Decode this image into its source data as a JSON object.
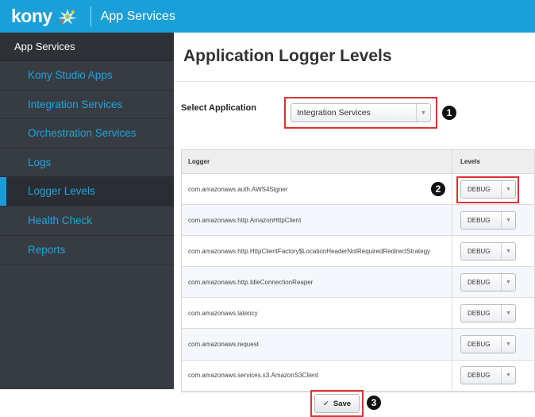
{
  "header": {
    "brand": "kony",
    "app_title": "App Services"
  },
  "sidebar": {
    "heading": "App Services",
    "items": [
      {
        "label": "Kony Studio Apps"
      },
      {
        "label": "Integration Services"
      },
      {
        "label": "Orchestration Services"
      },
      {
        "label": "Logs"
      },
      {
        "label": "Logger Levels",
        "active": true
      },
      {
        "label": "Health Check"
      },
      {
        "label": "Reports"
      }
    ]
  },
  "main": {
    "title": "Application Logger Levels",
    "select_label": "Select Application",
    "selected_application": "Integration Services",
    "table": {
      "headers": {
        "logger": "Logger",
        "levels": "Levels"
      },
      "rows": [
        {
          "logger": "com.amazonaws.auth.AWS4Signer",
          "level": "DEBUG"
        },
        {
          "logger": "com.amazonaws.http.AmazonHttpClient",
          "level": "DEBUG"
        },
        {
          "logger": "com.amazonaws.http.HttpClientFactory$LocationHeaderNotRequiredRedirectStrategy",
          "level": "DEBUG"
        },
        {
          "logger": "com.amazonaws.http.IdleConnectionReaper",
          "level": "DEBUG"
        },
        {
          "logger": "com.amazonaws.latency",
          "level": "DEBUG"
        },
        {
          "logger": "com.amazonaws.request",
          "level": "DEBUG"
        },
        {
          "logger": "com.amazonaws.services.s3.AmazonS3Client",
          "level": "DEBUG"
        }
      ]
    },
    "save_label": "Save",
    "save_icon": "✓"
  },
  "callouts": {
    "one": "1",
    "two": "2",
    "three": "3"
  },
  "colors": {
    "header_bg": "#1a9fd8",
    "sidebar_bg": "#373c42",
    "sidebar_link": "#21a3dc",
    "highlight": "#dd3333"
  }
}
